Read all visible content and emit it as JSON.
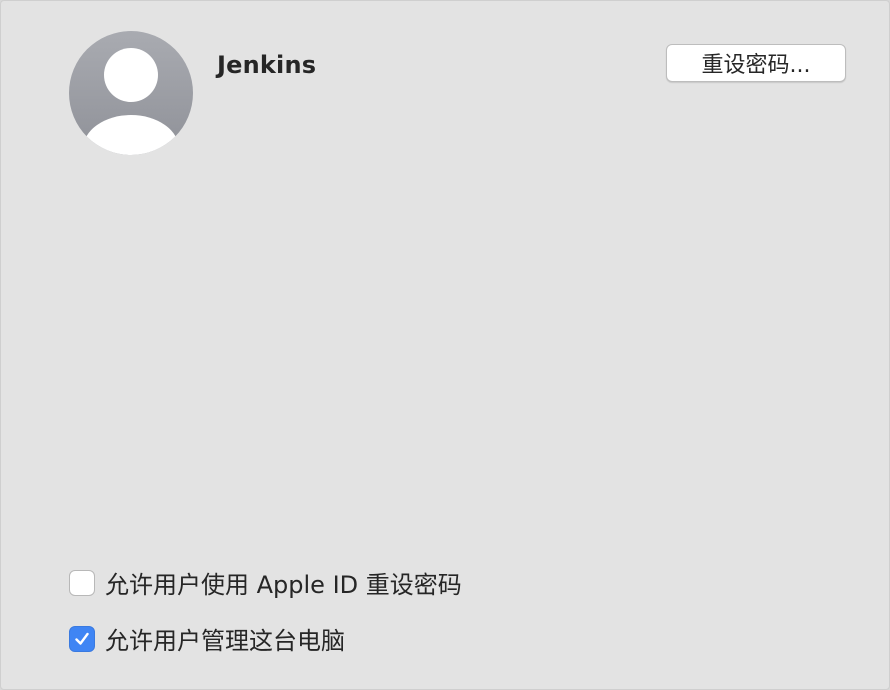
{
  "user": {
    "name": "Jenkins"
  },
  "buttons": {
    "reset_password_label": "重设密码..."
  },
  "options": [
    {
      "label": "允许用户使用 Apple ID 重设密码",
      "checked": false
    },
    {
      "label": "允许用户管理这台电脑",
      "checked": true
    }
  ],
  "colors": {
    "pane_background": "#e3e3e3",
    "checkbox_accent": "#3f85f4",
    "avatar_gradient_top": "#a9abb1",
    "avatar_gradient_bottom": "#8f9198"
  },
  "icons": {
    "avatar": "user-silhouette-icon",
    "check": "checkmark-icon"
  }
}
